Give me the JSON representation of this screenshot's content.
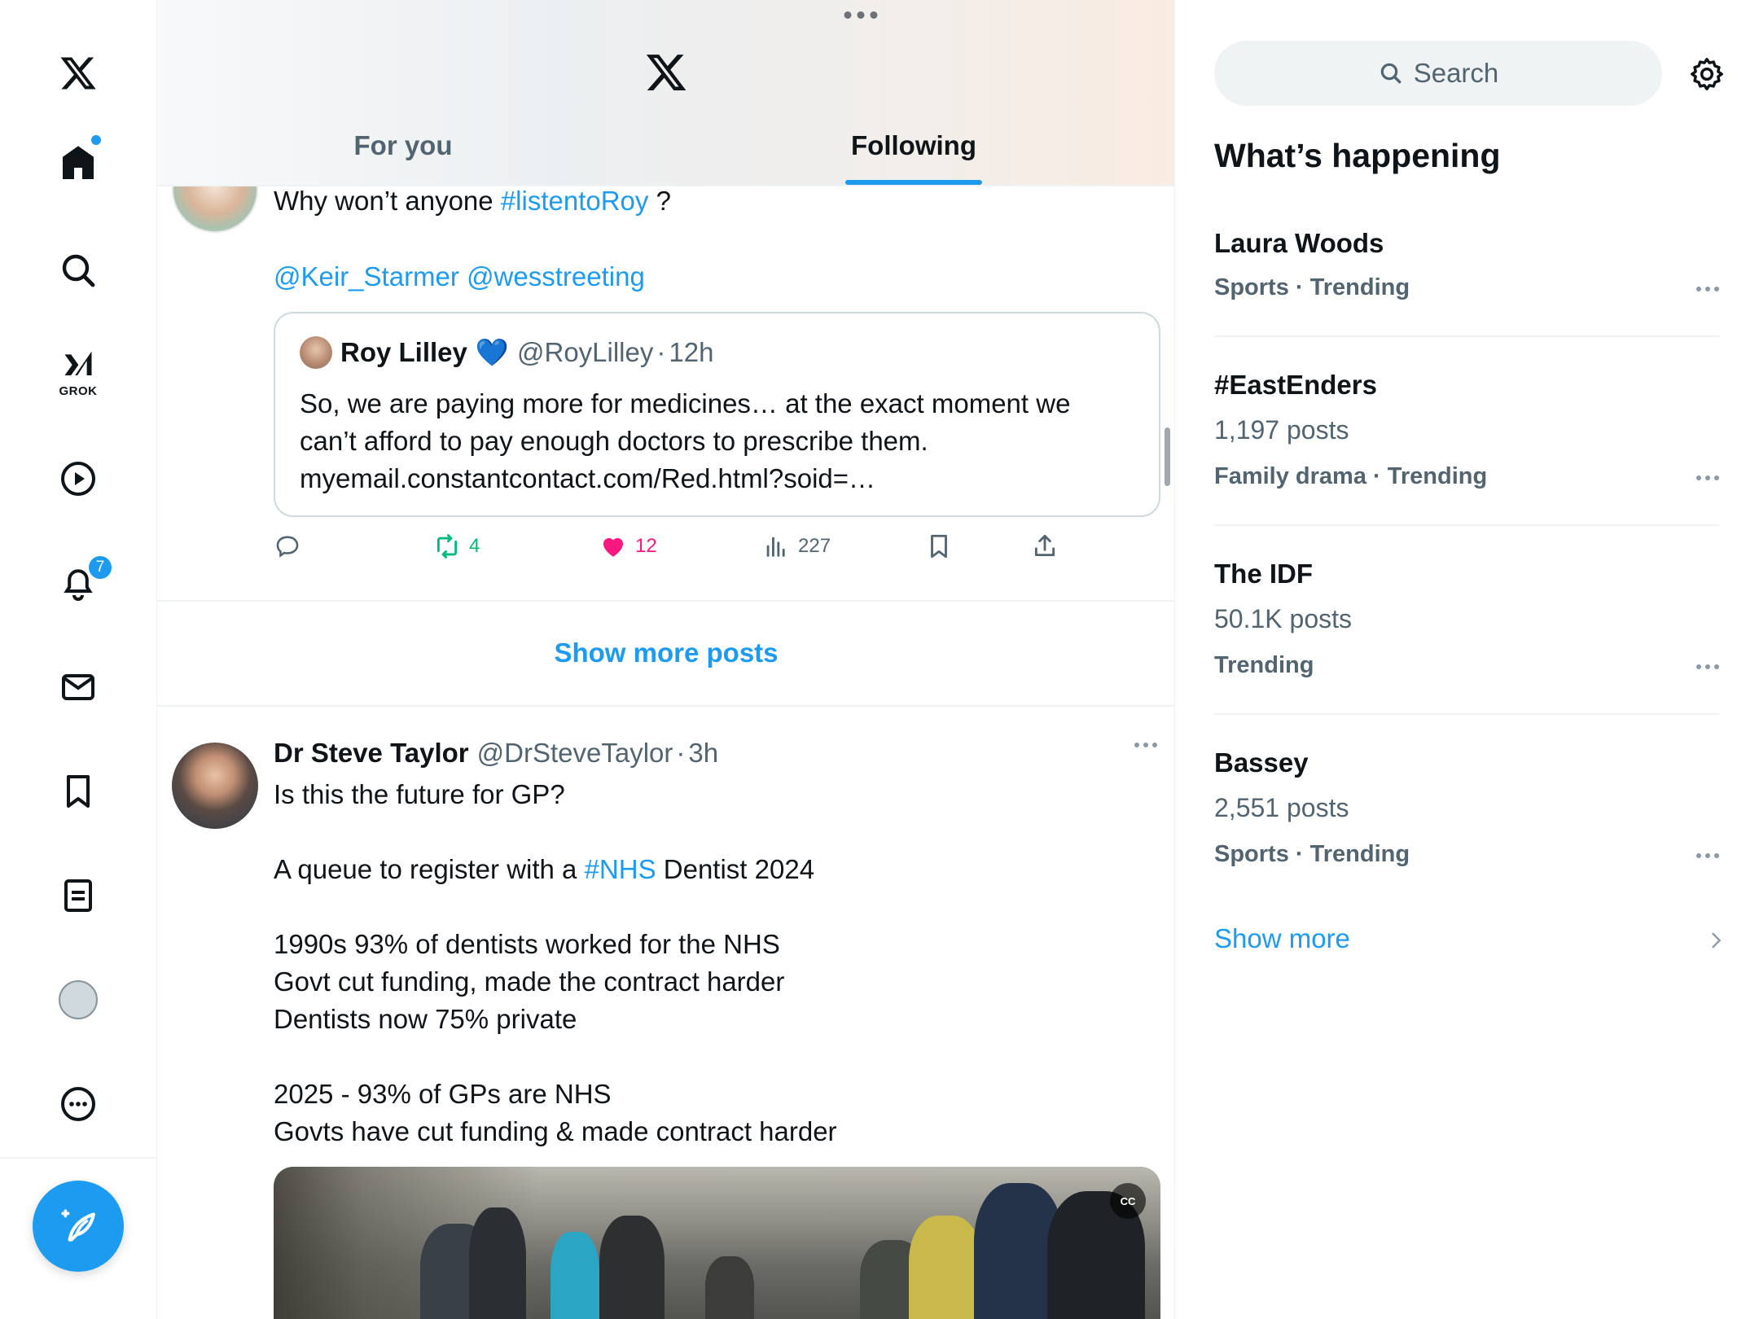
{
  "nav": {
    "notifications_count": "7",
    "grok_label": "GROK"
  },
  "header": {
    "tabs": [
      {
        "label": "For you",
        "active": false
      },
      {
        "label": "Following",
        "active": true
      }
    ]
  },
  "post1": {
    "text_prefix": "Why won’t anyone ",
    "hashtag": "#listentoRoy",
    "text_suffix": " ?",
    "mention1": "@Keir_Starmer",
    "mention2": "@wesstreeting",
    "quote": {
      "name": "Roy Lilley",
      "verified_emoji": "💙",
      "handle": "@RoyLilley",
      "dot": "·",
      "time": "12h",
      "lines": [
        "So, we are paying more for medicines… at the exact moment we",
        "can’t afford to pay enough doctors to prescribe them.",
        "myemail.constantcontact.com/Red.html?soid=…"
      ]
    },
    "actions": {
      "retweets": "4",
      "likes": "12",
      "views": "227"
    }
  },
  "show_more_posts": "Show more posts",
  "post2": {
    "name": "Dr Steve Taylor",
    "handle": "@DrSteveTaylor",
    "dot": "·",
    "time": "3h",
    "line1": "Is this the future for GP?",
    "line2_prefix": "A queue to register with a ",
    "line2_hashtag": "#NHS",
    "line2_suffix": " Dentist 2024",
    "line3": "1990s 93% of dentists worked for the NHS",
    "line4": "Govt cut funding, made the contract harder",
    "line5": "Dentists now 75% private",
    "line6": "2025 - 93% of GPs are NHS",
    "line7": "Govts have cut funding & made contract harder",
    "media_cc": "CC"
  },
  "sidebar": {
    "search_placeholder": "Search",
    "title": "What’s happening",
    "trends": [
      {
        "name": "Laura Woods",
        "posts": "",
        "category": "Sports · Trending"
      },
      {
        "name": "#EastEnders",
        "posts": "1,197 posts",
        "category": "Family drama · Trending"
      },
      {
        "name": "The IDF",
        "posts": "50.1K posts",
        "category": "Trending"
      },
      {
        "name": "Bassey",
        "posts": "2,551 posts",
        "category": "Sports · Trending"
      }
    ],
    "show_more": "Show more"
  },
  "colors": {
    "accent": "#1d9bf0",
    "retweet": "#00ba7c",
    "like": "#f91880",
    "muted": "#536471"
  }
}
